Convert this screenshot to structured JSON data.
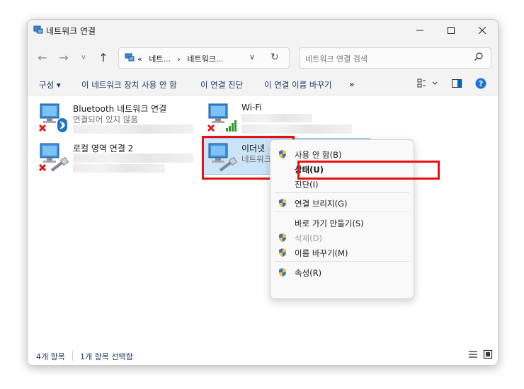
{
  "window": {
    "title": "네트워크 연결"
  },
  "address": {
    "crumbs": [
      "«",
      "네트...",
      "›",
      "네트워크..."
    ]
  },
  "search": {
    "placeholder": "네트워크 연결 검색"
  },
  "commands": {
    "organize": "구성 ▾",
    "disable": "이 네트워크 장치 사용 안 함",
    "diagnose": "이 연결 진단",
    "rename": "이 연결 이름 바꾸기",
    "more": "»"
  },
  "connections": [
    {
      "name": "Bluetooth 네트워크 연결",
      "status": "연결되어 있지 않음",
      "icon": "bluetooth-network-icon"
    },
    {
      "name": "Wi-Fi",
      "status": "",
      "icon": "wifi-network-icon"
    },
    {
      "name": "로컬 영역 연결 2",
      "status": "",
      "icon": "ethernet-disconnected-icon"
    },
    {
      "name": "이더넷",
      "status": "네트워크 2",
      "icon": "ethernet-network-icon"
    }
  ],
  "context_menu": {
    "items": [
      {
        "label": "사용 안 함(B)",
        "shield": true,
        "bold": false,
        "disabled": false
      },
      {
        "label": "상태(U)",
        "shield": false,
        "bold": true,
        "disabled": false
      },
      {
        "label": "진단(I)",
        "shield": false,
        "bold": false,
        "disabled": false
      },
      {
        "label": "연결 브리지(G)",
        "shield": true,
        "bold": false,
        "disabled": false
      },
      {
        "label": "바로 가기 만들기(S)",
        "shield": false,
        "bold": false,
        "disabled": false
      },
      {
        "label": "삭제(D)",
        "shield": true,
        "bold": false,
        "disabled": true
      },
      {
        "label": "이름 바꾸기(M)",
        "shield": true,
        "bold": false,
        "disabled": false
      },
      {
        "label": "속성(R)",
        "shield": true,
        "bold": false,
        "disabled": false
      }
    ]
  },
  "status": {
    "count": "4개 항목",
    "selected": "1개 항목 선택함"
  },
  "colors": {
    "accent": "#0067c0",
    "highlight": "#e81010",
    "selection": "#cce4f7"
  }
}
